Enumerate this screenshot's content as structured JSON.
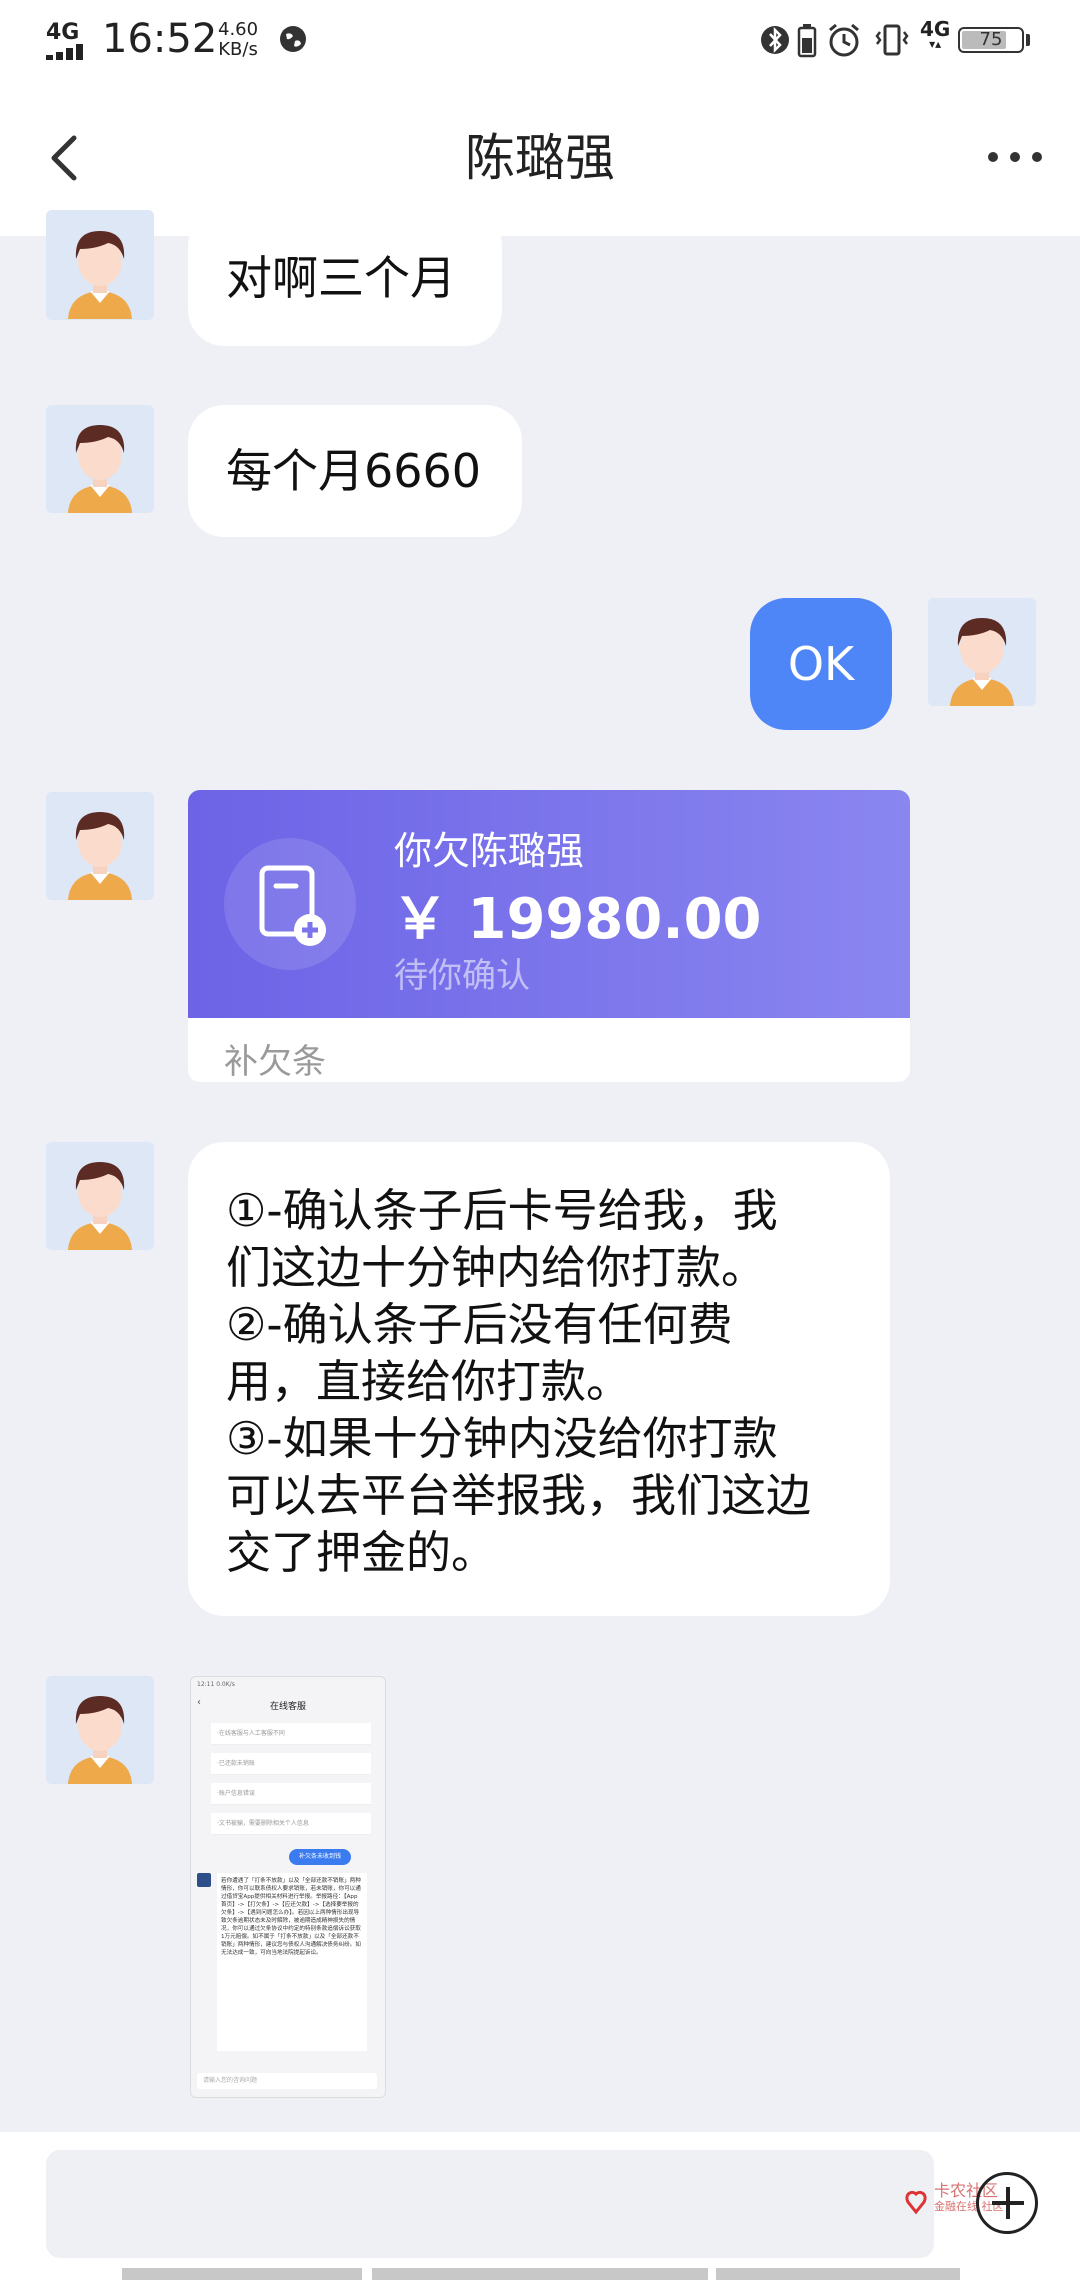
{
  "status_bar": {
    "network": "4G",
    "time": "16:52",
    "speed_value": "4.60",
    "speed_unit": "KB/s",
    "network_right": "4G",
    "battery": "75",
    "battery_level": 0.75
  },
  "header": {
    "title": "陈璐强"
  },
  "messages": {
    "m1": "对啊三个月",
    "m2": "每个月6660",
    "m3": "OK",
    "debt": {
      "title": "你欠陈璐强",
      "amount": "￥ 19980.00",
      "status": "待你确认",
      "footer": "补欠条"
    },
    "m5": [
      "①-确认条子后卡号给我，我",
      "们这边十分钟内给你打款。",
      "②-确认条子后没有任何费",
      "用，直接给你打款。",
      "③-如果十分钟内没给你打款",
      "可以去平台举报我，我们这边",
      "交了押金的。"
    ]
  },
  "screenshot_thumb": {
    "status": "12:11 0.0K/s",
    "title": "在线客服",
    "rows": [
      "·在线客服与人工客服不同",
      "·已还款未销账",
      "·账户信息错误",
      "·文书被骗，需要删除相关个人信息"
    ],
    "chip": "补欠条未收到钱",
    "body": "若你遭遇了「打条不放款」以及「全部还款不销账」两种情形，你可以联系债权人要求销账，若未销账，你可以通过借贷宝App提供相关材料进行举报。举报路径：【App首页】->【打欠条】->【应还欠款】->【选择要举报的欠条】->【遇到问题怎么办】。若因以上两种情形出现导致欠条逾期状态未及时解除，被逾期造成精神损失的情况，你可以通过欠条协议中约定的特别条款追偿诉讼获取1万元赔偿。如不属于「打条不放款」以及「全部还款不销账」两种情形，建议您与债权人沟通解决债务纠纷。如无法达成一致，可向当地法院提起诉讼。",
    "input": "请输入您的咨询问题"
  },
  "watermark": {
    "line1": "卡农社区",
    "line2": "金融在线 社区"
  }
}
